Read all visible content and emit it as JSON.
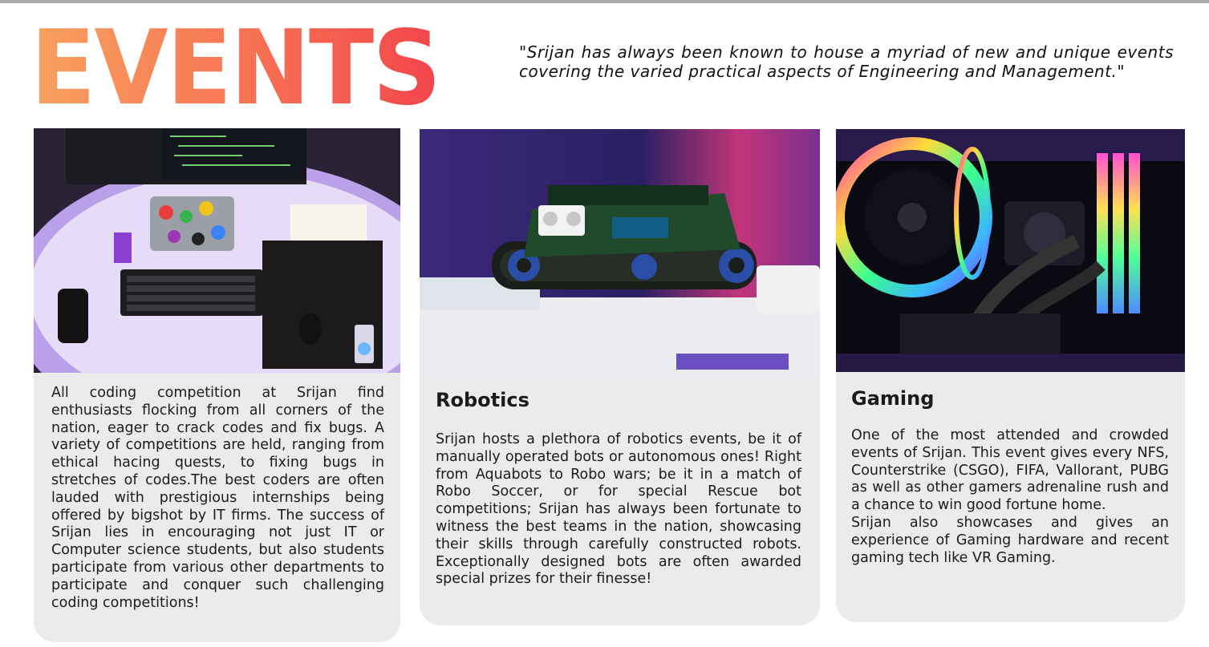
{
  "header": {
    "title": "EVENTS",
    "quote": "\"Srijan has always been known to house a myriad of new and unique events covering the varied practical aspects of Engineering and Management.\""
  },
  "cards": [
    {
      "id": "coding",
      "heading": "",
      "image_icon": "coding-desk-photo",
      "body": "All coding competition at Srijan find enthusiasts flocking from all corners of the nation, eager to crack codes and fix bugs. A variety of competitions are held, ranging from ethical hacing quests, to fixing bugs in stretches of codes.The best coders are often lauded with prestigious internships being offered by bigshot by IT firms. The success of Srijan lies in encouraging not just IT or Computer science students, but also students participate from various other departments to participate and conquer such challenging coding competitions!"
    },
    {
      "id": "robotics",
      "heading": "Robotics",
      "image_icon": "robot-tank-photo",
      "body": "Srijan hosts a plethora of robotics events, be it of manually operated bots or autonomous ones! Right from Aquabots to Robo wars; be it in a match of Robo Soccer, or for special Rescue bot competitions; Srijan has always been fortunate to witness the best teams in the nation, showcasing their skills through carefully constructed robots. Exceptionally designed bots are often awarded special prizes for their finesse!"
    },
    {
      "id": "gaming",
      "heading": "Gaming",
      "image_icon": "rgb-pc-photo",
      "body_1": "One of the most attended and crowded events of Srijan. This event gives every NFS, Counterstrike (CSGO), FIFA, Vallorant, PUBG as well as other gamers adrenaline rush and a chance to win good fortune home.",
      "body_2": "Srijan also showcases and gives an experience of Gaming hardware and recent gaming tech like VR Gaming."
    }
  ],
  "colors": {
    "title_gradient_start": "#f7a25f",
    "title_gradient_end": "#f2454b",
    "card_background": "#ebebeb",
    "top_rule": "#a9a9a9"
  }
}
